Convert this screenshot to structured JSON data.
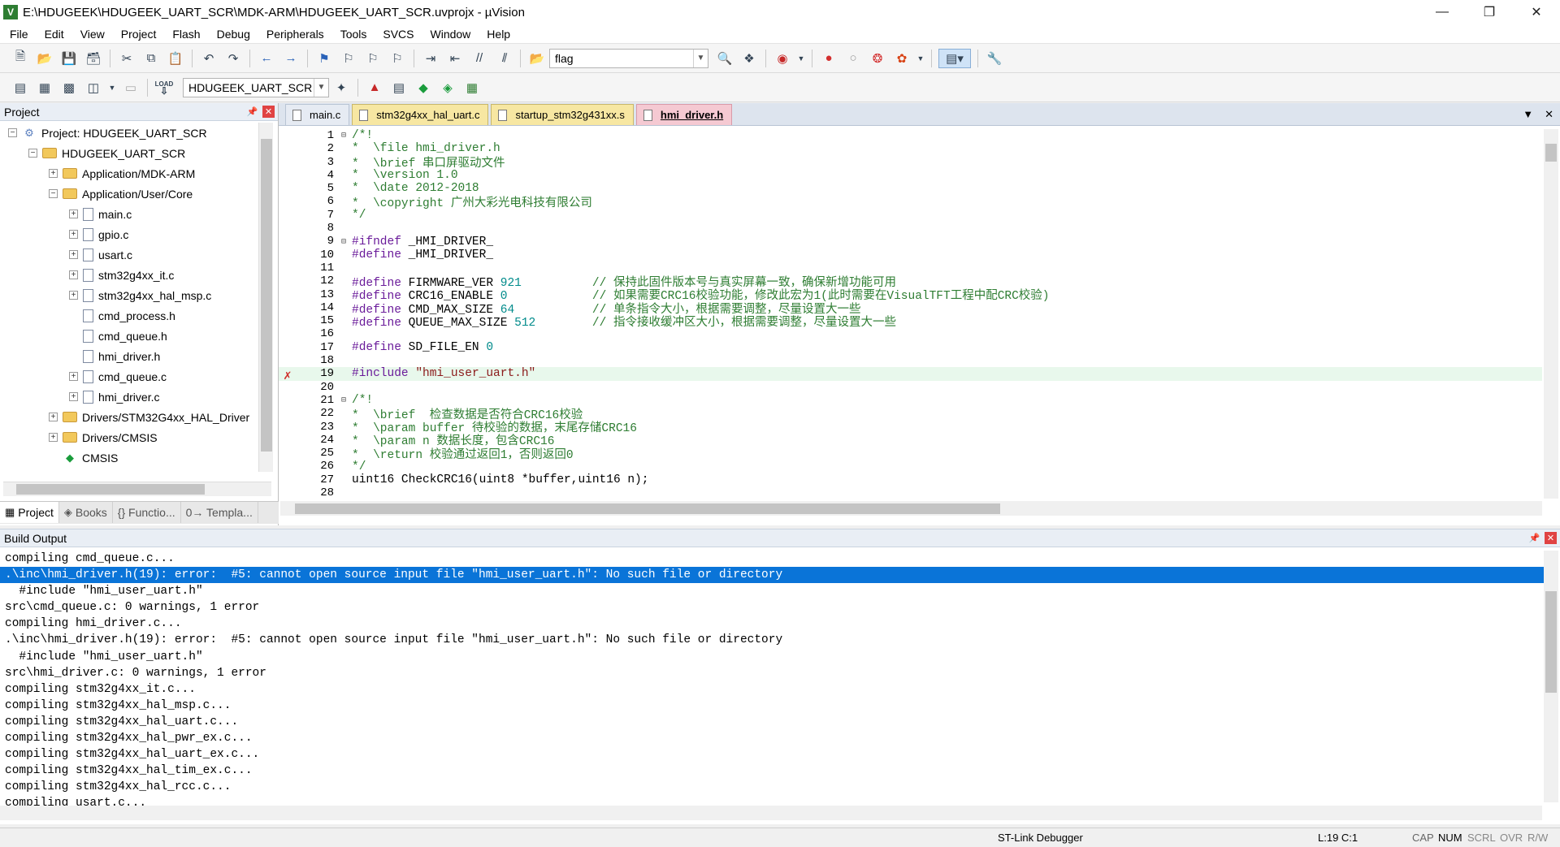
{
  "window": {
    "title": "E:\\HDUGEEK\\HDUGEEK_UART_SCR\\MDK-ARM\\HDUGEEK_UART_SCR.uvprojx - µVision",
    "icon": "V"
  },
  "menu": [
    "File",
    "Edit",
    "View",
    "Project",
    "Flash",
    "Debug",
    "Peripherals",
    "Tools",
    "SVCS",
    "Window",
    "Help"
  ],
  "toolbar1": {
    "find_value": "flag"
  },
  "toolbar2": {
    "target_value": "HDUGEEK_UART_SCR",
    "load_label": "LOAD"
  },
  "project_pane": {
    "title": "Project",
    "tree": [
      {
        "label": "Project: HDUGEEK_UART_SCR",
        "depth": 0,
        "exp": "-",
        "icon": "proj"
      },
      {
        "label": "HDUGEEK_UART_SCR",
        "depth": 1,
        "exp": "-",
        "icon": "folder"
      },
      {
        "label": "Application/MDK-ARM",
        "depth": 2,
        "exp": "+",
        "icon": "folder"
      },
      {
        "label": "Application/User/Core",
        "depth": 2,
        "exp": "-",
        "icon": "folder"
      },
      {
        "label": "main.c",
        "depth": 3,
        "exp": "+",
        "icon": "file"
      },
      {
        "label": "gpio.c",
        "depth": 3,
        "exp": "+",
        "icon": "file"
      },
      {
        "label": "usart.c",
        "depth": 3,
        "exp": "+",
        "icon": "file"
      },
      {
        "label": "stm32g4xx_it.c",
        "depth": 3,
        "exp": "+",
        "icon": "file"
      },
      {
        "label": "stm32g4xx_hal_msp.c",
        "depth": 3,
        "exp": "+",
        "icon": "file"
      },
      {
        "label": "cmd_process.h",
        "depth": 3,
        "exp": "",
        "icon": "file"
      },
      {
        "label": "cmd_queue.h",
        "depth": 3,
        "exp": "",
        "icon": "file"
      },
      {
        "label": "hmi_driver.h",
        "depth": 3,
        "exp": "",
        "icon": "file"
      },
      {
        "label": "cmd_queue.c",
        "depth": 3,
        "exp": "+",
        "icon": "file"
      },
      {
        "label": "hmi_driver.c",
        "depth": 3,
        "exp": "+",
        "icon": "file"
      },
      {
        "label": "Drivers/STM32G4xx_HAL_Driver",
        "depth": 2,
        "exp": "+",
        "icon": "folder"
      },
      {
        "label": "Drivers/CMSIS",
        "depth": 2,
        "exp": "+",
        "icon": "folder"
      },
      {
        "label": "CMSIS",
        "depth": 2,
        "exp": "",
        "icon": "cmsis"
      }
    ],
    "tabs": [
      "Project",
      "Books",
      "{} Functio...",
      "0→ Templa..."
    ]
  },
  "editor": {
    "tabs": [
      {
        "label": "main.c",
        "style": "main"
      },
      {
        "label": "stm32g4xx_hal_uart.c",
        "style": "normal"
      },
      {
        "label": "startup_stm32g431xx.s",
        "style": "normal"
      },
      {
        "label": "hmi_driver.h",
        "style": "active"
      }
    ],
    "lines": [
      {
        "n": "1",
        "fold": "⊟",
        "parts": [
          [
            "c-cmt",
            "/*!"
          ]
        ]
      },
      {
        "n": "2",
        "parts": [
          [
            "c-cmt",
            "*  \\file hmi_driver.h"
          ]
        ]
      },
      {
        "n": "3",
        "parts": [
          [
            "c-cmt",
            "*  \\brief 串口屏驱动文件"
          ]
        ]
      },
      {
        "n": "4",
        "parts": [
          [
            "c-cmt",
            "*  \\version 1.0"
          ]
        ]
      },
      {
        "n": "5",
        "parts": [
          [
            "c-cmt",
            "*  \\date 2012-2018"
          ]
        ]
      },
      {
        "n": "6",
        "parts": [
          [
            "c-cmt",
            "*  \\copyright 广州大彩光电科技有限公司"
          ]
        ]
      },
      {
        "n": "7",
        "parts": [
          [
            "c-cmt",
            "*/"
          ]
        ]
      },
      {
        "n": "8",
        "parts": []
      },
      {
        "n": "9",
        "fold": "⊟",
        "parts": [
          [
            "c-pp",
            "#ifndef"
          ],
          [
            "c-kw",
            " _HMI_DRIVER_"
          ]
        ]
      },
      {
        "n": "10",
        "parts": [
          [
            "c-pp",
            "#define"
          ],
          [
            "c-kw",
            " _HMI_DRIVER_"
          ]
        ]
      },
      {
        "n": "11",
        "parts": []
      },
      {
        "n": "12",
        "parts": [
          [
            "c-pp",
            "#define"
          ],
          [
            "c-kw",
            " FIRMWARE_VER "
          ],
          [
            "c-num",
            "921"
          ],
          [
            "c-kw",
            "          "
          ],
          [
            "c-cmt",
            "// 保持此固件版本号与真实屏幕一致，确保新增功能可用"
          ]
        ]
      },
      {
        "n": "13",
        "parts": [
          [
            "c-pp",
            "#define"
          ],
          [
            "c-kw",
            " CRC16_ENABLE "
          ],
          [
            "c-num",
            "0"
          ],
          [
            "c-kw",
            "            "
          ],
          [
            "c-cmt",
            "// 如果需要CRC16校验功能，修改此宏为1(此时需要在VisualTFT工程中配CRC校验)"
          ]
        ]
      },
      {
        "n": "14",
        "parts": [
          [
            "c-pp",
            "#define"
          ],
          [
            "c-kw",
            " CMD_MAX_SIZE "
          ],
          [
            "c-num",
            "64"
          ],
          [
            "c-kw",
            "           "
          ],
          [
            "c-cmt",
            "// 单条指令大小，根据需要调整，尽量设置大一些"
          ]
        ]
      },
      {
        "n": "15",
        "parts": [
          [
            "c-pp",
            "#define"
          ],
          [
            "c-kw",
            " QUEUE_MAX_SIZE "
          ],
          [
            "c-num",
            "512"
          ],
          [
            "c-kw",
            "        "
          ],
          [
            "c-cmt",
            "// 指令接收缓冲区大小，根据需要调整，尽量设置大一些"
          ]
        ]
      },
      {
        "n": "16",
        "parts": []
      },
      {
        "n": "17",
        "parts": [
          [
            "c-pp",
            "#define"
          ],
          [
            "c-kw",
            " SD_FILE_EN "
          ],
          [
            "c-num",
            "0"
          ]
        ]
      },
      {
        "n": "18",
        "parts": []
      },
      {
        "n": "19",
        "hl": true,
        "err": true,
        "parts": [
          [
            "c-pp",
            "#include"
          ],
          [
            "c-kw",
            " "
          ],
          [
            "c-str",
            "\"hmi_user_uart.h\""
          ]
        ]
      },
      {
        "n": "20",
        "parts": []
      },
      {
        "n": "21",
        "fold": "⊟",
        "parts": [
          [
            "c-cmt",
            "/*!"
          ]
        ]
      },
      {
        "n": "22",
        "parts": [
          [
            "c-cmt",
            "*  \\brief  检查数据是否符合CRC16校验"
          ]
        ]
      },
      {
        "n": "23",
        "parts": [
          [
            "c-cmt",
            "*  \\param buffer 待校验的数据，末尾存储CRC16"
          ]
        ]
      },
      {
        "n": "24",
        "parts": [
          [
            "c-cmt",
            "*  \\param n 数据长度，包含CRC16"
          ]
        ]
      },
      {
        "n": "25",
        "parts": [
          [
            "c-cmt",
            "*  \\return 校验通过返回1，否则返回0"
          ]
        ]
      },
      {
        "n": "26",
        "parts": [
          [
            "c-cmt",
            "*/"
          ]
        ]
      },
      {
        "n": "27",
        "parts": [
          [
            "c-kw",
            "uint16 CheckCRC16(uint8 *buffer,uint16 n);"
          ]
        ]
      },
      {
        "n": "28",
        "parts": []
      }
    ]
  },
  "build_output": {
    "title": "Build Output",
    "lines": [
      "compiling cmd_queue.c...",
      ".\\inc\\hmi_driver.h(19): error:  #5: cannot open source input file \"hmi_user_uart.h\": No such file or directory",
      "  #include \"hmi_user_uart.h\"",
      "src\\cmd_queue.c: 0 warnings, 1 error",
      "compiling hmi_driver.c...",
      ".\\inc\\hmi_driver.h(19): error:  #5: cannot open source input file \"hmi_user_uart.h\": No such file or directory",
      "  #include \"hmi_user_uart.h\"",
      "src\\hmi_driver.c: 0 warnings, 1 error",
      "compiling stm32g4xx_it.c...",
      "compiling stm32g4xx_hal_msp.c...",
      "compiling stm32g4xx_hal_uart.c...",
      "compiling stm32g4xx_hal_pwr_ex.c...",
      "compiling stm32g4xx_hal_uart_ex.c...",
      "compiling stm32g4xx_hal_tim_ex.c...",
      "compiling stm32g4xx_hal_rcc.c...",
      "compiling usart.c..."
    ],
    "selected_index": 1
  },
  "status": {
    "debugger": "ST-Link Debugger",
    "position": "L:19 C:1",
    "cap": "CAP",
    "num": "NUM",
    "scrl": "SCRL",
    "ovr": "OVR",
    "rw": "R/W"
  }
}
